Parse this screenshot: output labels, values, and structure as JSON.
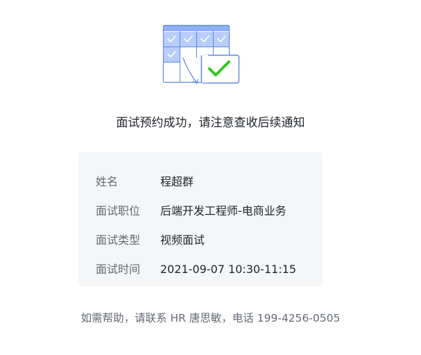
{
  "illustration": {
    "icon": "calendar-check-icon",
    "colors": {
      "header": "#8fb0f5",
      "cell_filled": "#b8cdfa",
      "outline": "#5b86e5",
      "check": "#34c724"
    }
  },
  "message": "面试预约成功，请注意查收后续通知",
  "details": [
    {
      "label": "姓名",
      "value": "程超群"
    },
    {
      "label": "面试职位",
      "value": "后端开发工程师-电商业务"
    },
    {
      "label": "面试类型",
      "value": "视频面试"
    },
    {
      "label": "面试时间",
      "value": "2021-09-07 10:30-11:15"
    }
  ],
  "help_text": "如需帮助，请联系 HR 唐思敏，电话 199-4256-0505"
}
